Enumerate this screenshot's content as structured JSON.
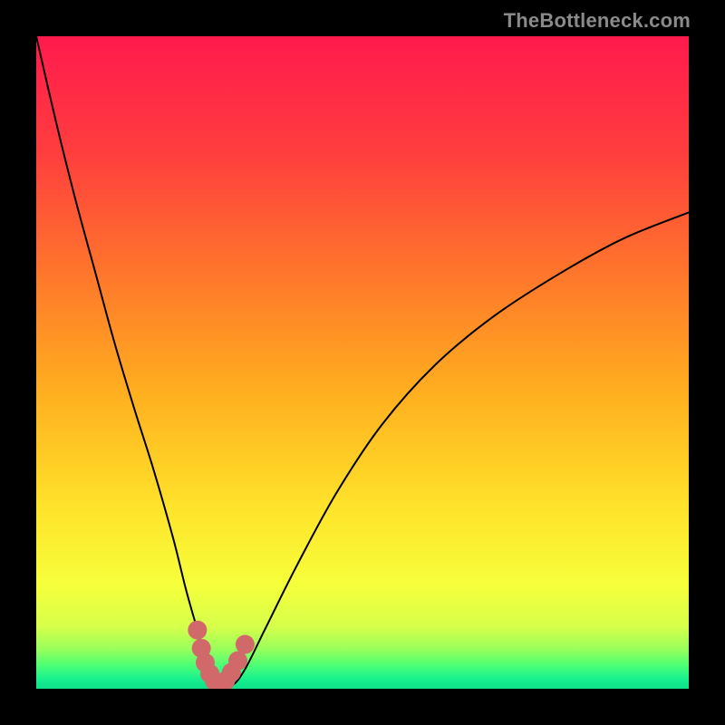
{
  "watermark": "TheBottleneck.com",
  "colors": {
    "black": "#000000",
    "curve": "#000000",
    "markerFill": "#d1696b",
    "markerStroke": "#c35a5c",
    "gradientStops": [
      {
        "offset": 0.0,
        "color": "#ff1a4d"
      },
      {
        "offset": 0.18,
        "color": "#ff3e3e"
      },
      {
        "offset": 0.38,
        "color": "#ff7b2a"
      },
      {
        "offset": 0.55,
        "color": "#ffb01f"
      },
      {
        "offset": 0.72,
        "color": "#ffe22a"
      },
      {
        "offset": 0.84,
        "color": "#f6ff3b"
      },
      {
        "offset": 0.905,
        "color": "#d6ff4a"
      },
      {
        "offset": 0.94,
        "color": "#97ff5c"
      },
      {
        "offset": 0.965,
        "color": "#4bff77"
      },
      {
        "offset": 0.985,
        "color": "#18f18f"
      },
      {
        "offset": 1.0,
        "color": "#0fe08a"
      }
    ]
  },
  "chart_data": {
    "type": "line",
    "title": "",
    "xlabel": "",
    "ylabel": "",
    "xlim": [
      0,
      100
    ],
    "ylim": [
      0,
      100
    ],
    "series": [
      {
        "name": "bottleneck-curve",
        "x": [
          0,
          3,
          6,
          9,
          12,
          15,
          18,
          21,
          23,
          25,
          26.5,
          28,
          30,
          32,
          35,
          40,
          46,
          53,
          61,
          70,
          80,
          90,
          100
        ],
        "values": [
          100,
          87,
          75,
          64,
          53,
          43,
          33.5,
          23,
          15,
          8,
          3,
          0.7,
          0.5,
          3,
          9,
          19,
          30,
          40.5,
          49.5,
          57,
          63.5,
          69,
          73
        ]
      }
    ],
    "markers": {
      "name": "min-markers",
      "x": [
        24.7,
        25.3,
        25.9,
        26.6,
        27.3,
        28.1,
        29.0,
        29.9,
        30.9,
        32.0
      ],
      "values": [
        9.0,
        6.2,
        4.0,
        2.3,
        1.2,
        0.8,
        1.2,
        2.5,
        4.3,
        6.8
      ]
    }
  }
}
